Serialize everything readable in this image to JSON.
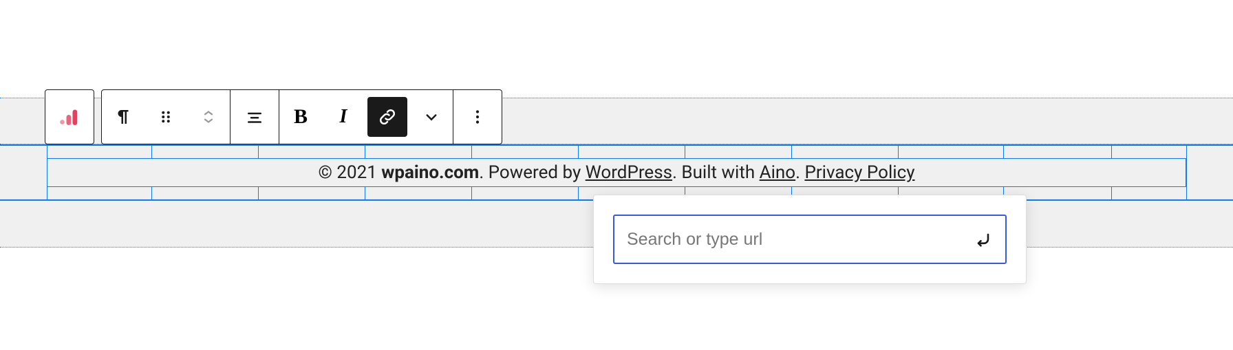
{
  "toolbar": {
    "logo_color": "#e83f5b",
    "bold_label": "B",
    "italic_label": "I"
  },
  "footer": {
    "copyright_prefix": "© 2021 ",
    "site_name": "wpaino.com",
    "powered_by_prefix": ". Powered by ",
    "powered_by_link": "WordPress",
    "built_with_prefix": ". Built with ",
    "built_with_link": "Aino",
    "privacy_prefix": ". ",
    "privacy_link": "Privacy Policy"
  },
  "link_popover": {
    "placeholder": "Search or type url",
    "value": ""
  },
  "grid": {
    "vline_positions": [
      68,
      220,
      375,
      530,
      685,
      840,
      995,
      1150,
      1305,
      1458,
      1615,
      1724
    ]
  }
}
